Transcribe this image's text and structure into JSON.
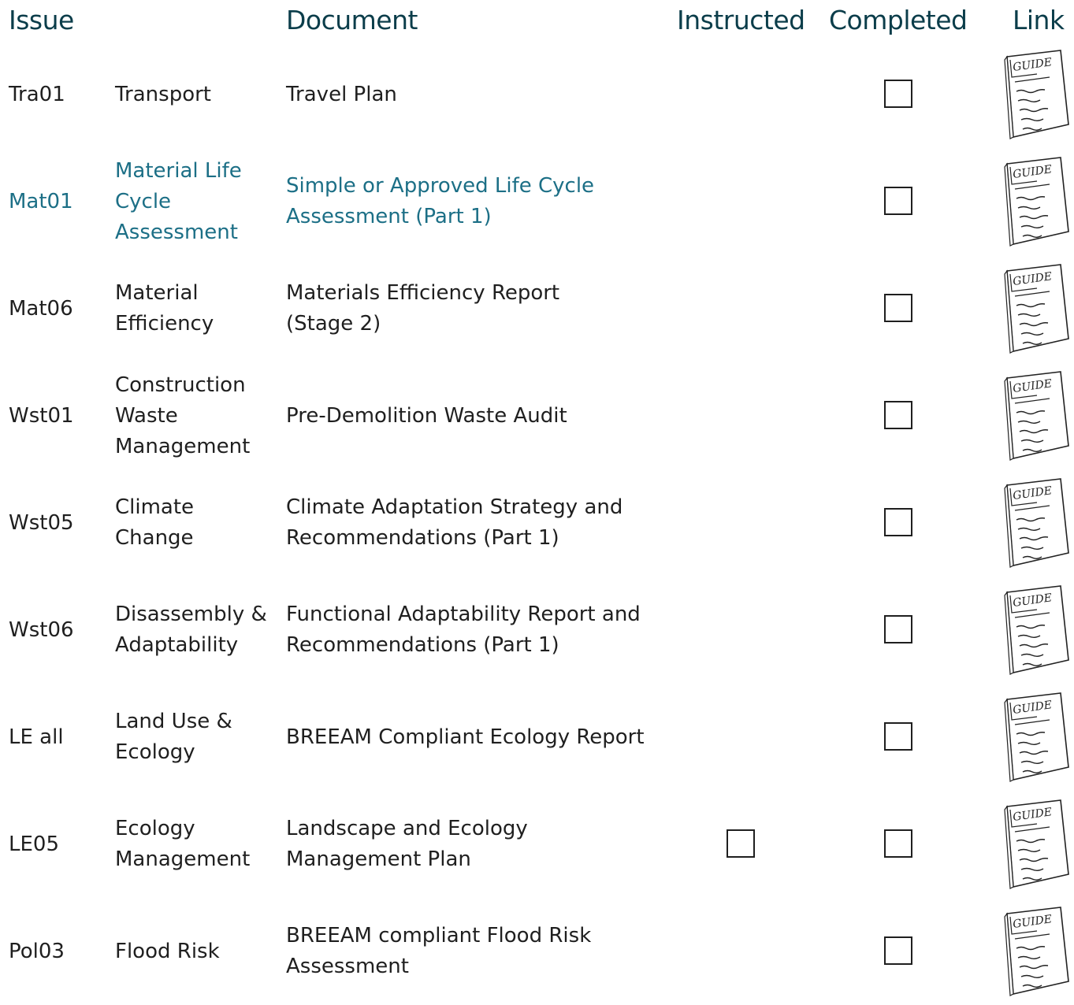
{
  "headers": {
    "issue": "Issue",
    "document": "Document",
    "instructed": "Instructed",
    "completed": "Completed",
    "link": "Link"
  },
  "guide_label": "GUIDE",
  "colors": {
    "header": "#0b3d4a",
    "highlight": "#1c6f86",
    "text": "#1f1f1f"
  },
  "rows": [
    {
      "code": "Tra01",
      "issue": [
        "Transport"
      ],
      "document": [
        "Travel Plan"
      ],
      "instructed": false,
      "highlighted": false,
      "instructed_box": false
    },
    {
      "code": "Mat01",
      "issue": [
        "Material Life",
        "Cycle",
        "Assessment"
      ],
      "document": [
        "Simple or Approved Life Cycle",
        "Assessment (Part 1)"
      ],
      "highlighted": true,
      "instructed_box": false
    },
    {
      "code": "Mat06",
      "issue": [
        "Material",
        "Efficiency"
      ],
      "document": [
        "Materials Efficiency Report",
        "(Stage 2)"
      ],
      "highlighted": false,
      "instructed_box": false
    },
    {
      "code": "Wst01",
      "issue": [
        "Construction",
        "Waste",
        "Management"
      ],
      "document": [
        "Pre-Demolition Waste Audit"
      ],
      "highlighted": false,
      "instructed_box": false
    },
    {
      "code": "Wst05",
      "issue": [
        "Climate",
        "Change"
      ],
      "document": [
        "Climate Adaptation Strategy and",
        "Recommendations (Part 1)"
      ],
      "highlighted": false,
      "instructed_box": false
    },
    {
      "code": "Wst06",
      "issue": [
        "Disassembly &",
        "Adaptability"
      ],
      "document": [
        "Functional Adaptability Report and",
        "Recommendations (Part 1)"
      ],
      "highlighted": false,
      "instructed_box": false
    },
    {
      "code": "LE all",
      "issue": [
        "Land Use &",
        "Ecology"
      ],
      "document": [
        "BREEAM Compliant Ecology Report"
      ],
      "highlighted": false,
      "instructed_box": false
    },
    {
      "code": "LE05",
      "issue": [
        "Ecology",
        "Management"
      ],
      "document": [
        "Landscape and Ecology",
        "Management Plan"
      ],
      "highlighted": false,
      "instructed_box": true
    },
    {
      "code": "Pol03",
      "issue": [
        "Flood Risk"
      ],
      "document": [
        "BREEAM compliant Flood Risk",
        "Assessment"
      ],
      "highlighted": false,
      "instructed_box": false
    }
  ]
}
